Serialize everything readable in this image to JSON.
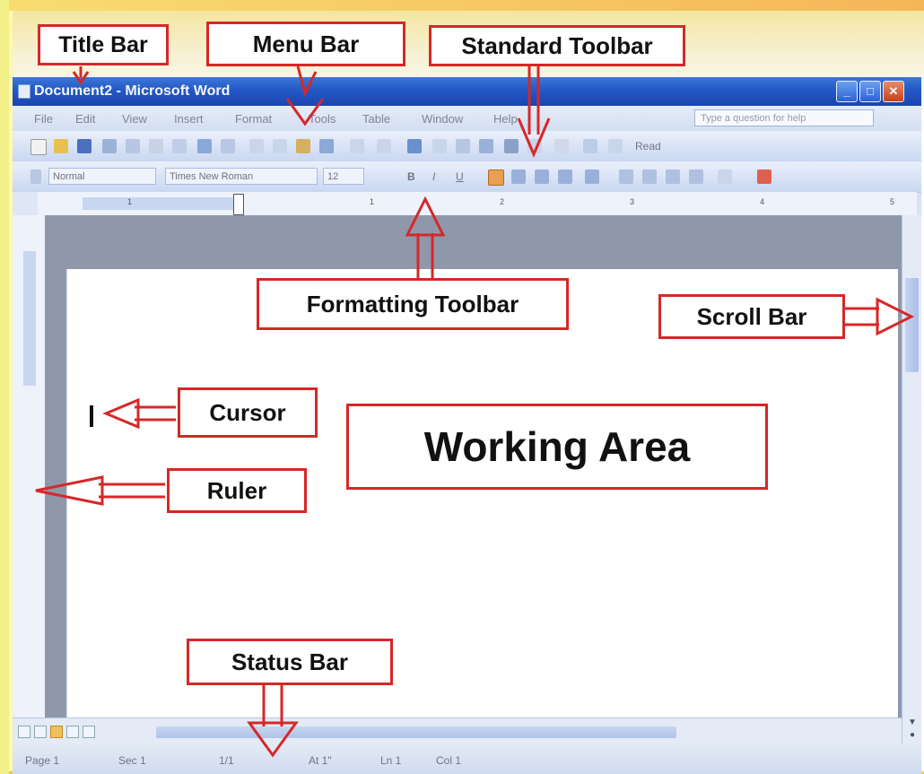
{
  "window": {
    "title": "Document2 - Microsoft Word",
    "buttons": {
      "minimize": "_",
      "maximize": "□",
      "close": "✕"
    }
  },
  "menu": {
    "items": [
      "File",
      "Edit",
      "View",
      "Insert",
      "Format",
      "Tools",
      "Table",
      "Window",
      "Help"
    ],
    "help_placeholder": "Type a question for help"
  },
  "standard_toolbar": {
    "read_label": "Read"
  },
  "formatting_toolbar": {
    "style": "Normal",
    "font": "Times New Roman",
    "size": "12",
    "bold": "B",
    "italic": "I",
    "underline": "U"
  },
  "ruler": {
    "numbers": [
      "1",
      "1",
      "2",
      "3",
      "4",
      "5"
    ]
  },
  "status_bar": {
    "page": "Page 1",
    "sec": "Sec 1",
    "pages": "1/1",
    "at": "At 1\"",
    "ln": "Ln 1",
    "col": "Col 1"
  },
  "annotations": {
    "title_bar": "Title Bar",
    "menu_bar": "Menu Bar",
    "standard_toolbar": "Standard Toolbar",
    "formatting_toolbar": "Formatting Toolbar",
    "scroll_bar": "Scroll Bar",
    "cursor": "Cursor",
    "working_area": "Working  Area",
    "ruler": "Ruler",
    "status_bar": "Status Bar"
  },
  "colors": {
    "annotation_border": "#d62828",
    "title_bar_blue": "#2458c6",
    "background_yellow": "#f6c96a"
  }
}
